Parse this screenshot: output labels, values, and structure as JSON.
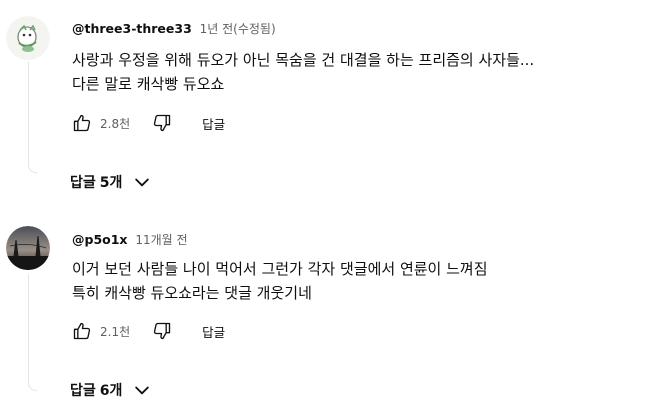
{
  "comments": [
    {
      "author": "@three3-three33",
      "meta": "1년 전(수정됨)",
      "text_lines": [
        "사랑과 우정을 위해 듀오가 아닌 목숨을 건 대결을 하는 프리즘의 사자들...",
        "다른 말로 캐삭빵 듀오쇼"
      ],
      "likes": "2.8천",
      "reply_label": "답글",
      "replies_label": "답글",
      "replies_count": "5개"
    },
    {
      "author": "@p5o1x",
      "meta": "11개월 전",
      "text_lines": [
        "이거 보던 사람들 나이 먹어서 그런가 각자 댓글에서 연륜이 느껴짐",
        "특히 캐삭빵 듀오쇼라는 댓글 개웃기네"
      ],
      "likes": "2.1천",
      "reply_label": "답글",
      "replies_label": "답글",
      "replies_count": "6개"
    }
  ],
  "icons": {
    "like": "thumbs-up-icon",
    "dislike": "thumbs-down-icon",
    "expand": "chevron-down-icon"
  }
}
